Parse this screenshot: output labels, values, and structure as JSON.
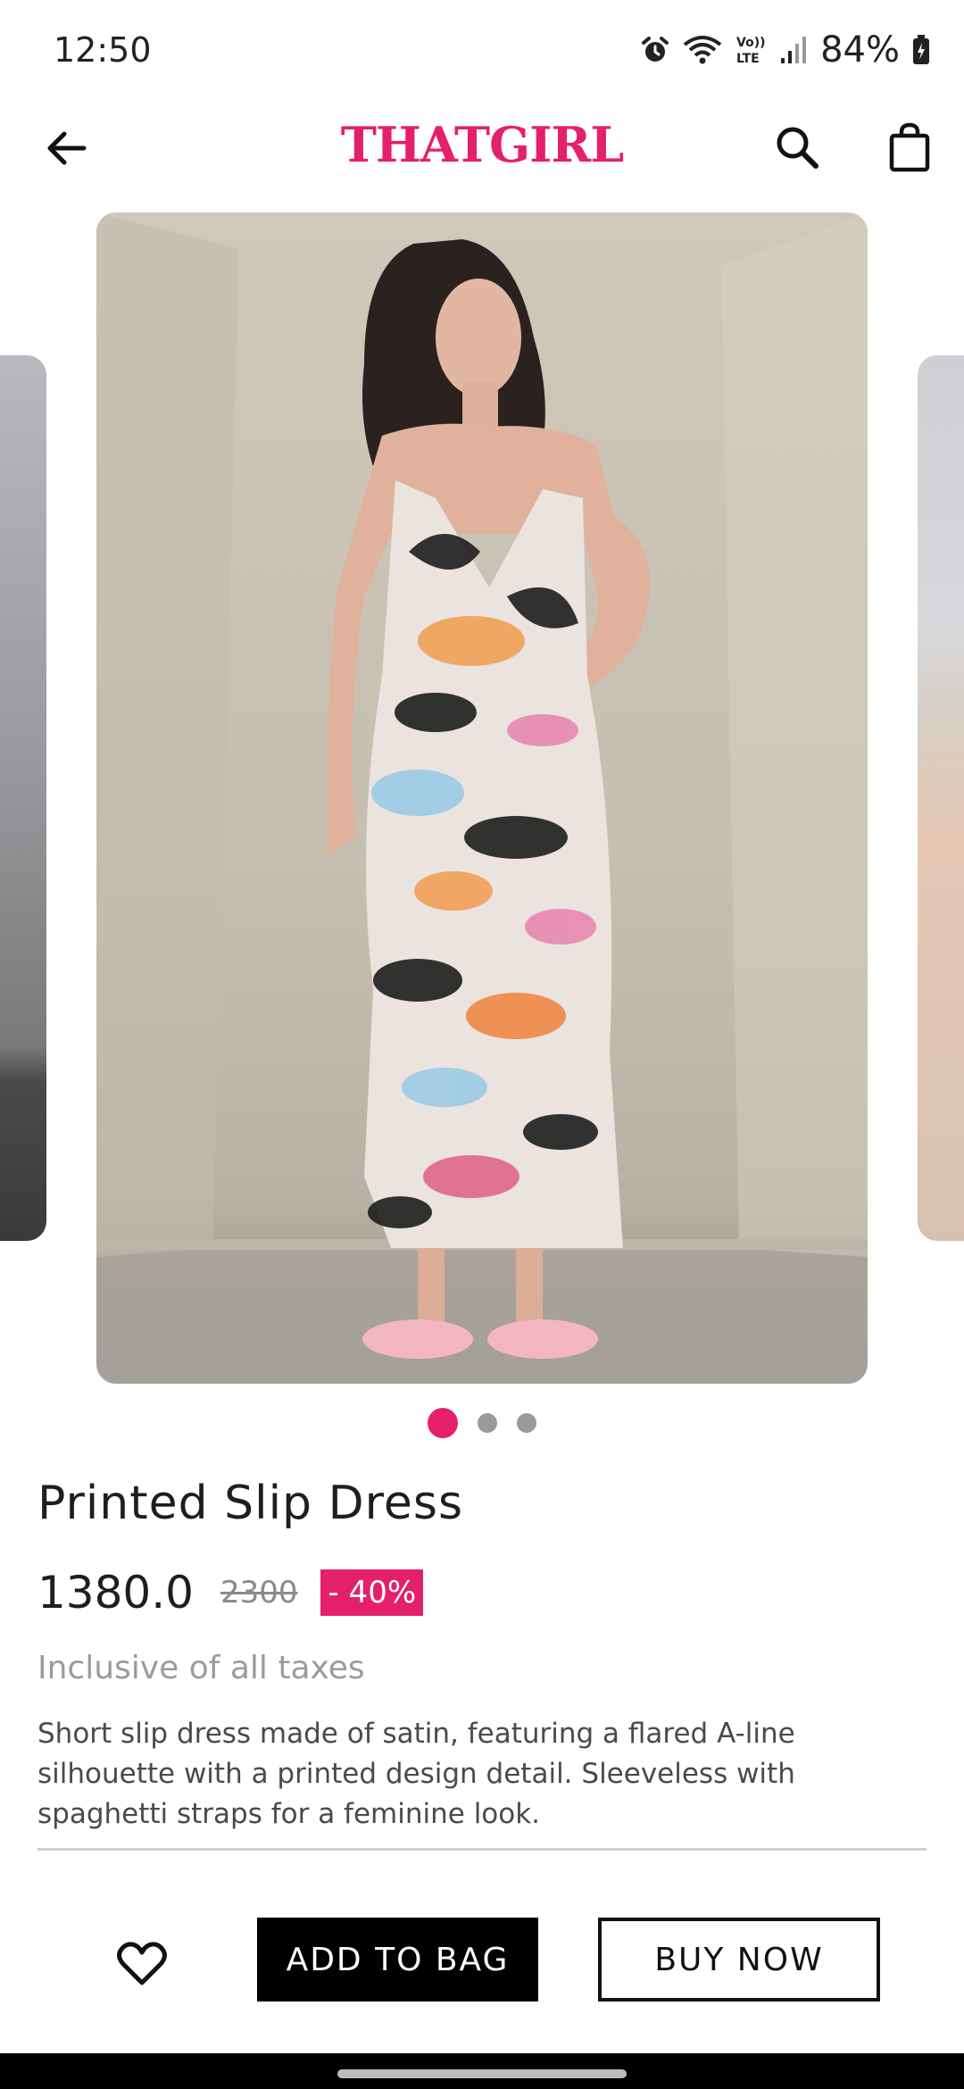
{
  "status_bar": {
    "time": "12:50",
    "battery": "84%",
    "icons": [
      "alarm-icon",
      "wifi-icon",
      "volte-icon",
      "signal-icon",
      "battery-icon"
    ]
  },
  "header": {
    "brand": "THATGIRL",
    "brand_color": "#e4206b",
    "icons": [
      "back-arrow-icon",
      "search-icon",
      "shopping-bag-icon"
    ]
  },
  "carousel": {
    "image_count": 3,
    "active_index": 0,
    "active_color": "#e4206b"
  },
  "product": {
    "title": "Printed Slip Dress",
    "price": "1380.0",
    "original_price": "2300",
    "discount": "- 40%",
    "tax_note": "Inclusive of all taxes",
    "description": "Short slip dress made of satin, featuring a flared A-line silhouette with a printed design detail. Sleeveless with spaghetti straps for a feminine look."
  },
  "actions": {
    "wishlist_icon": "heart-outline-icon",
    "add_to_bag": "ADD TO BAG",
    "buy_now": "BUY NOW"
  }
}
